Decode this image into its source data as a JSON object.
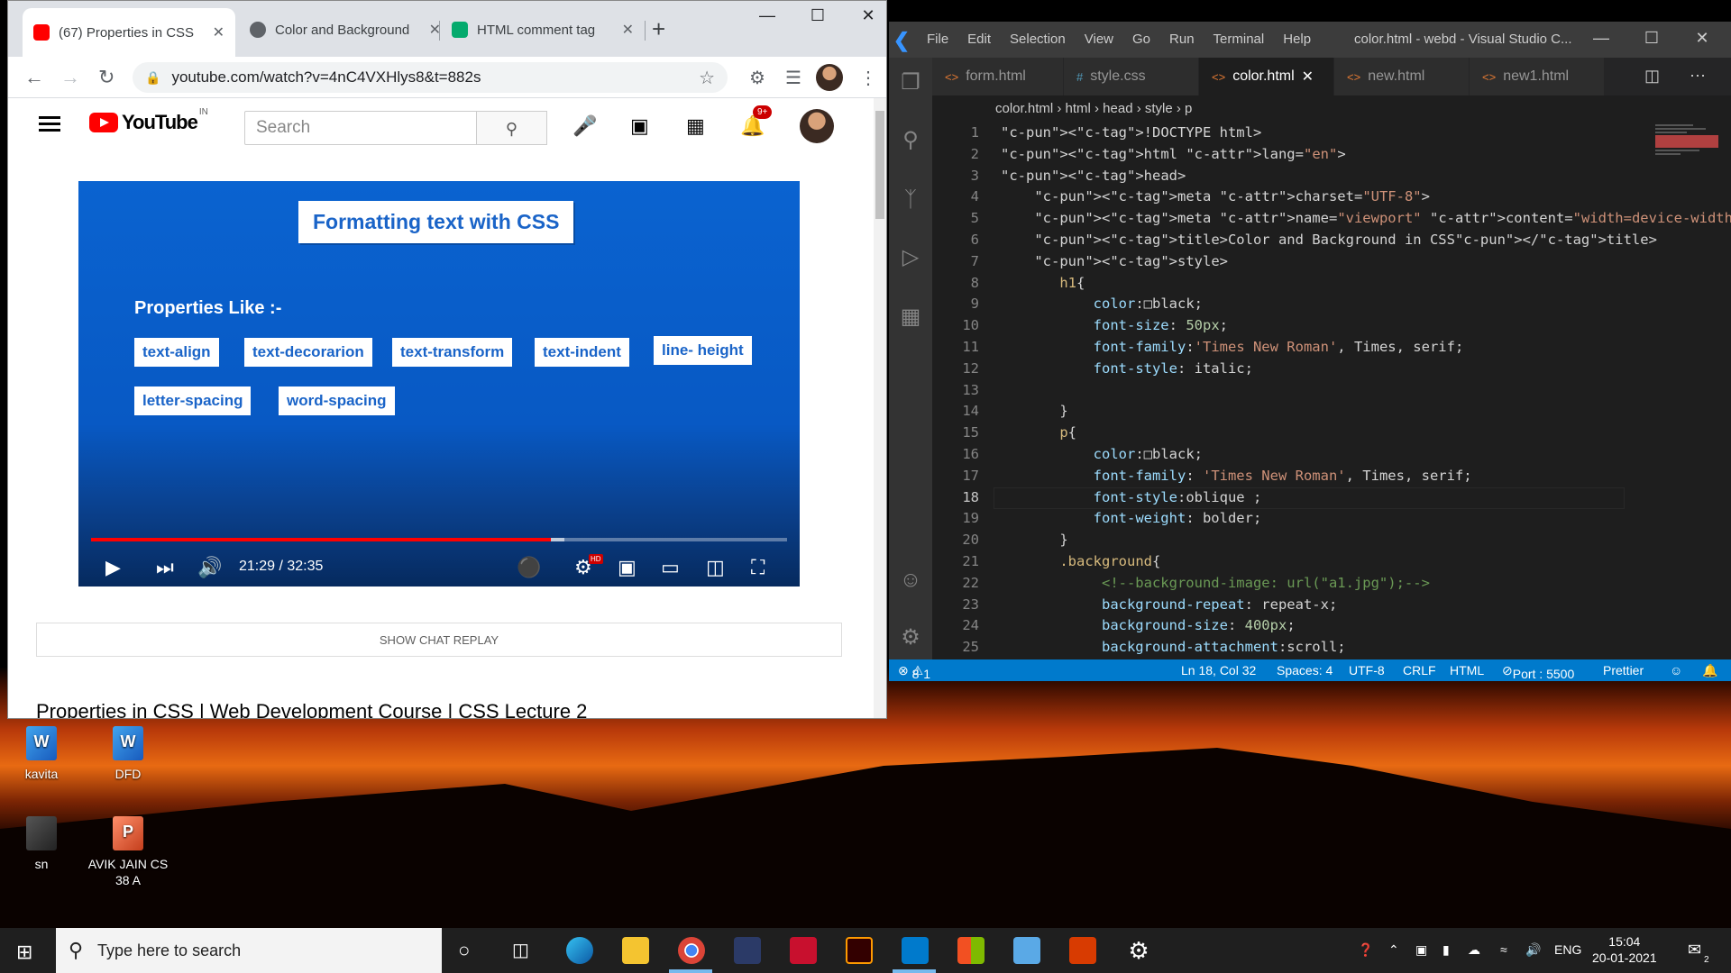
{
  "chrome": {
    "tabs": [
      {
        "title": "(67) Properties in CSS",
        "close": "✕"
      },
      {
        "title": "Color and Background",
        "close": "✕"
      },
      {
        "title": "HTML comment tag",
        "close": "✕"
      }
    ],
    "new_tab": "+",
    "url": "youtube.com/watch?v=4nC4VXHlys8&t=882s"
  },
  "youtube": {
    "logo_text": "YouTube",
    "region": "IN",
    "search_placeholder": "Search",
    "notifications_badge": "9+",
    "slide": {
      "title": "Formatting text with CSS",
      "properties_label": "Properties Like :-",
      "chips": [
        "text-align",
        "text-decorarion",
        "text-transform",
        "text-indent",
        "line- height",
        "letter-spacing",
        "word-spacing"
      ]
    },
    "player": {
      "time": "21:29 / 32:35",
      "progress": 0.66,
      "hd_badge": "HD"
    },
    "show_chat_replay": "SHOW CHAT REPLAY",
    "video_title": "Properties in CSS | Web Development Course | CSS Lecture 2"
  },
  "vscode": {
    "menu": [
      "File",
      "Edit",
      "Selection",
      "View",
      "Go",
      "Run",
      "Terminal",
      "Help"
    ],
    "window_title": "color.html - webd - Visual Studio C...",
    "tabs": [
      {
        "label": "form.html",
        "icon": "<>"
      },
      {
        "label": "style.css",
        "icon": "#"
      },
      {
        "label": "color.html",
        "icon": "<>",
        "close": "✕"
      },
      {
        "label": "new.html",
        "icon": "<>"
      },
      {
        "label": "new1.html",
        "icon": "<>"
      }
    ],
    "breadcrumb": "color.html  ›  html  ›  head  ›  style  ›  p",
    "code_lines": [
      {
        "n": "1",
        "text": "<!DOCTYPE html>"
      },
      {
        "n": "2",
        "text": "<html lang=\"en\">"
      },
      {
        "n": "3",
        "text": "<head>"
      },
      {
        "n": "4",
        "text": "    <meta charset=\"UTF-8\">"
      },
      {
        "n": "5",
        "text": "    <meta name=\"viewport\" content=\"width=device-width, initial-scale=1.0\">"
      },
      {
        "n": "6",
        "text": "    <title>Color and Background in CSS</title>"
      },
      {
        "n": "7",
        "text": "    <style>"
      },
      {
        "n": "8",
        "text": "       h1{"
      },
      {
        "n": "9",
        "text": "           color:□black;"
      },
      {
        "n": "10",
        "text": "           font-size: 50px;"
      },
      {
        "n": "11",
        "text": "           font-family:'Times New Roman', Times, serif;"
      },
      {
        "n": "12",
        "text": "           font-style: italic;"
      },
      {
        "n": "13",
        "text": ""
      },
      {
        "n": "14",
        "text": "       }"
      },
      {
        "n": "15",
        "text": "       p{"
      },
      {
        "n": "16",
        "text": "           color:□black;"
      },
      {
        "n": "17",
        "text": "           font-family: 'Times New Roman', Times, serif;"
      },
      {
        "n": "18",
        "text": "           font-style:oblique ;"
      },
      {
        "n": "19",
        "text": "           font-weight: bolder;"
      },
      {
        "n": "20",
        "text": "       }"
      },
      {
        "n": "21",
        "text": "       .background{"
      },
      {
        "n": "22",
        "text": "            <!--background-image: url(\"a1.jpg\");-->"
      },
      {
        "n": "23",
        "text": "            background-repeat: repeat-x;"
      },
      {
        "n": "24",
        "text": "            background-size: 400px;"
      },
      {
        "n": "25",
        "text": "            background-attachment:scroll;"
      }
    ],
    "status": {
      "errors": "8",
      "warnings": "1",
      "position": "Ln 18, Col 32",
      "spaces": "Spaces: 4",
      "encoding": "UTF-8",
      "eol": "CRLF",
      "language": "HTML",
      "port": "Port : 5500",
      "formatter": "Prettier"
    }
  },
  "desktop": {
    "icons": [
      {
        "label": "kavita"
      },
      {
        "label": "DFD"
      },
      {
        "label": "sn"
      },
      {
        "label": "AVIK JAIN CS 38 A"
      }
    ]
  },
  "taskbar": {
    "search_placeholder": "Type here to search",
    "language": "ENG",
    "time": "15:04",
    "date": "20-01-2021",
    "notification_count": "2"
  }
}
